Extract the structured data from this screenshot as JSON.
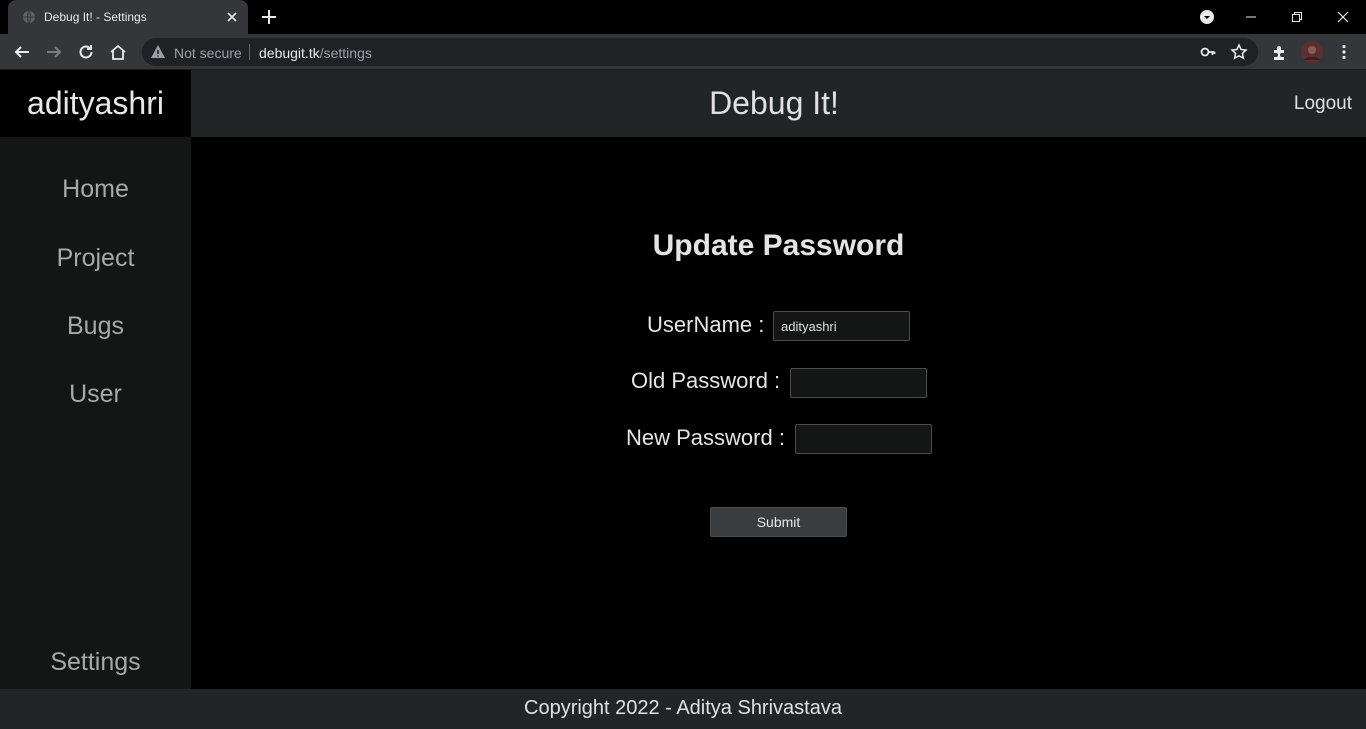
{
  "browser": {
    "tab_title": "Debug It! - Settings",
    "not_secure_label": "Not secure",
    "url_host": "debugit.tk",
    "url_path": "/settings"
  },
  "app": {
    "brand": "adityashri",
    "title": "Debug It!",
    "logout_label": "Logout"
  },
  "sidebar": {
    "items": [
      {
        "label": "Home"
      },
      {
        "label": "Project"
      },
      {
        "label": "Bugs"
      },
      {
        "label": "User"
      }
    ],
    "settings_label": "Settings"
  },
  "form": {
    "heading": "Update Password",
    "username_label": "UserName :",
    "username_value": "adityashri",
    "old_password_label": "Old Password :",
    "old_password_value": "",
    "new_password_label": "New Password :",
    "new_password_value": "",
    "submit_label": "Submit"
  },
  "footer": {
    "copyright": "Copyright 2022 - Aditya Shrivastava"
  }
}
